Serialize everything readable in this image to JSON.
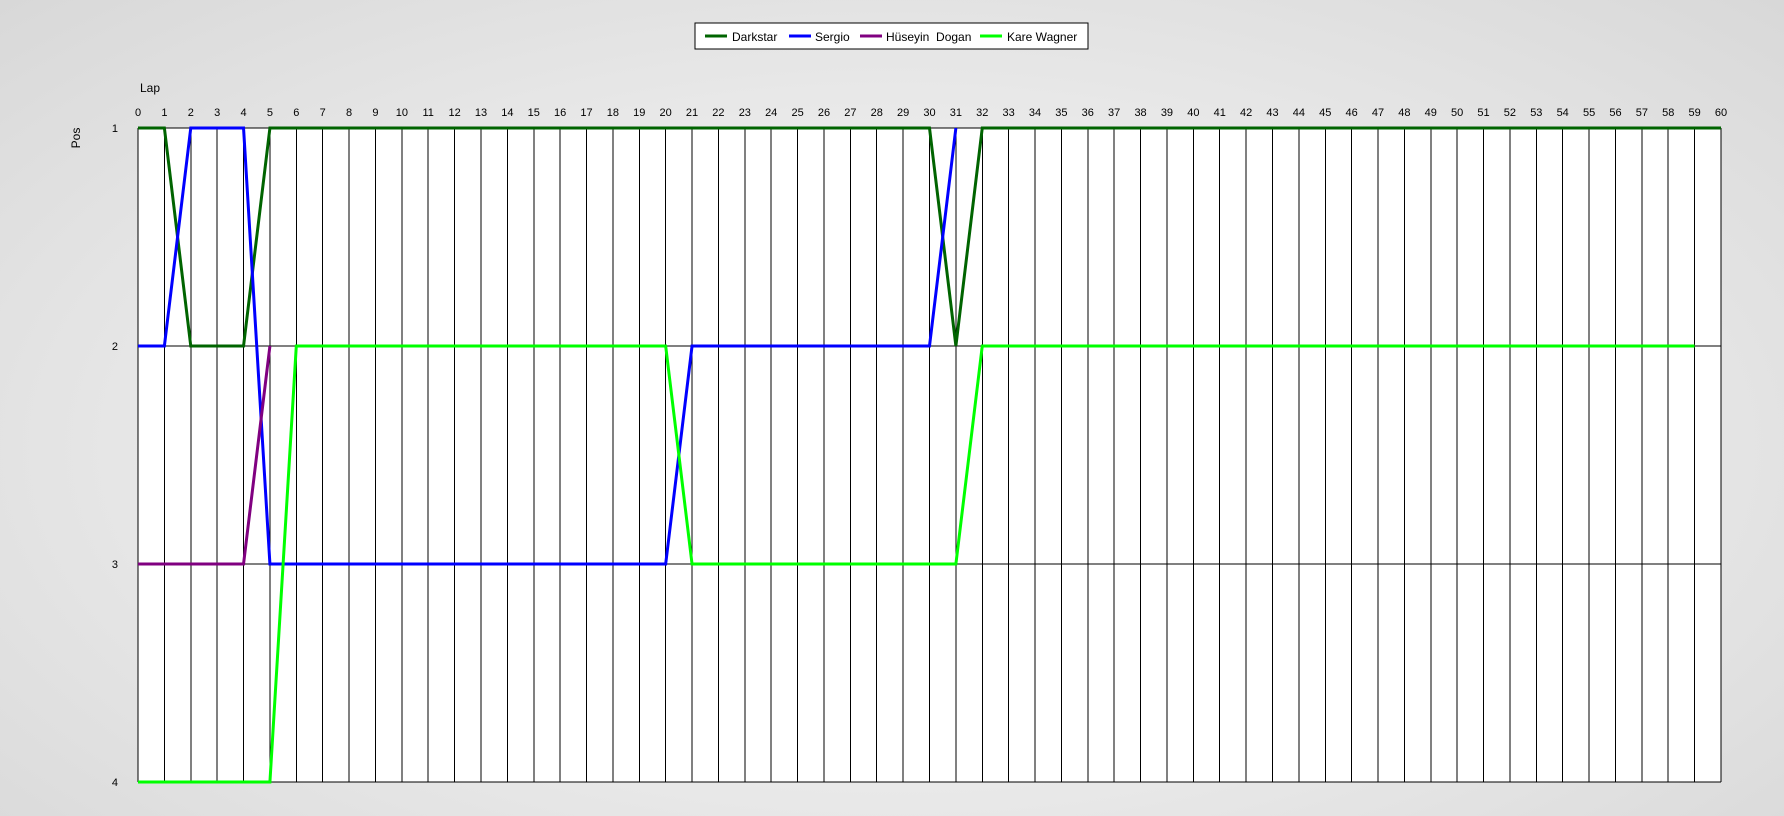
{
  "chart_data": {
    "type": "line",
    "title": "",
    "xlabel": "Lap",
    "ylabel": "Pos",
    "x_axis_position": "top",
    "y_axis_inverted": true,
    "xlim": [
      0,
      60
    ],
    "ylim": [
      1,
      4
    ],
    "x_ticks": [
      0,
      1,
      2,
      3,
      4,
      5,
      6,
      7,
      8,
      9,
      10,
      11,
      12,
      13,
      14,
      15,
      16,
      17,
      18,
      19,
      20,
      21,
      22,
      23,
      24,
      25,
      26,
      27,
      28,
      29,
      30,
      31,
      32,
      33,
      34,
      35,
      36,
      37,
      38,
      39,
      40,
      41,
      42,
      43,
      44,
      45,
      46,
      47,
      48,
      49,
      50,
      51,
      52,
      53,
      54,
      55,
      56,
      57,
      58,
      59,
      60
    ],
    "y_ticks": [
      1,
      2,
      3,
      4
    ],
    "grid": true,
    "legend_position": "top-center",
    "series": [
      {
        "name": "Darkstar",
        "color": "#006400",
        "points": [
          [
            0,
            1
          ],
          [
            1,
            1
          ],
          [
            2,
            2
          ],
          [
            4,
            2
          ],
          [
            5,
            1
          ],
          [
            30,
            1
          ],
          [
            31,
            2
          ],
          [
            32,
            1
          ],
          [
            60,
            1
          ]
        ]
      },
      {
        "name": "Sergio",
        "color": "#0000FF",
        "points": [
          [
            0,
            2
          ],
          [
            1,
            2
          ],
          [
            2,
            1
          ],
          [
            4,
            1
          ],
          [
            5,
            3
          ],
          [
            20,
            3
          ],
          [
            21,
            2
          ],
          [
            30,
            2
          ],
          [
            31,
            1
          ]
        ]
      },
      {
        "name": "Hüseyin  Dogan",
        "color": "#800080",
        "points": [
          [
            0,
            3
          ],
          [
            4,
            3
          ],
          [
            5,
            2
          ]
        ]
      },
      {
        "name": "Kare Wagner",
        "color": "#00FF00",
        "points": [
          [
            0,
            4
          ],
          [
            5,
            4
          ],
          [
            6,
            2
          ],
          [
            20,
            2
          ],
          [
            21,
            3
          ],
          [
            31,
            3
          ],
          [
            32,
            2
          ],
          [
            59,
            2
          ]
        ]
      }
    ]
  }
}
